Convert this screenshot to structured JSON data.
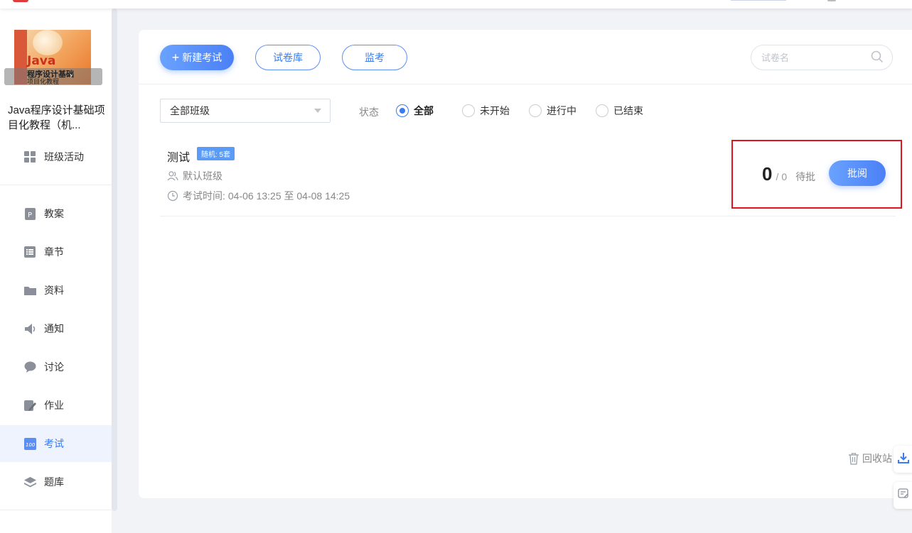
{
  "sidebar": {
    "cover": {
      "cover_word": "Java",
      "bar_title": "程序设计基础",
      "bar_subtitle": "项目化教程"
    },
    "course_title": "Java程序设计基础项目化教程（机...",
    "items": [
      {
        "label": "班级活动",
        "icon": "grid-icon"
      },
      {
        "label": "教案",
        "icon": "lesson-plan-icon"
      },
      {
        "label": "章节",
        "icon": "chapter-list-icon"
      },
      {
        "label": "资料",
        "icon": "folder-icon"
      },
      {
        "label": "通知",
        "icon": "speaker-icon"
      },
      {
        "label": "讨论",
        "icon": "chat-bubble-icon"
      },
      {
        "label": "作业",
        "icon": "homework-icon"
      },
      {
        "label": "考试",
        "icon": "exam-icon",
        "active": true
      },
      {
        "label": "题库",
        "icon": "layers-icon"
      }
    ]
  },
  "toolbar": {
    "new_exam": "新建考试",
    "paper_library": "试卷库",
    "proctor": "监考",
    "search_placeholder": "试卷名"
  },
  "filters": {
    "class_select": "全部班级",
    "status_label": "状态",
    "status_options": [
      {
        "label": "全部",
        "selected": true
      },
      {
        "label": "未开始",
        "selected": false
      },
      {
        "label": "进行中",
        "selected": false
      },
      {
        "label": "已结束",
        "selected": false
      }
    ]
  },
  "exams": [
    {
      "title": "测试",
      "badge": "随机: 5套",
      "class_name": "默认班级",
      "time_label": "考试时间:",
      "time_range": "04-06 13:25 至 04-08 14:25",
      "graded": "0",
      "total": "0",
      "slash": "/",
      "pending_label": "待批",
      "review_button": "批阅"
    }
  ],
  "footer": {
    "recycle_bin": "回收站"
  },
  "colors": {
    "accent": "#3a7bf0",
    "highlight_box": "#e0141e",
    "badge": "#5a9bf7"
  }
}
